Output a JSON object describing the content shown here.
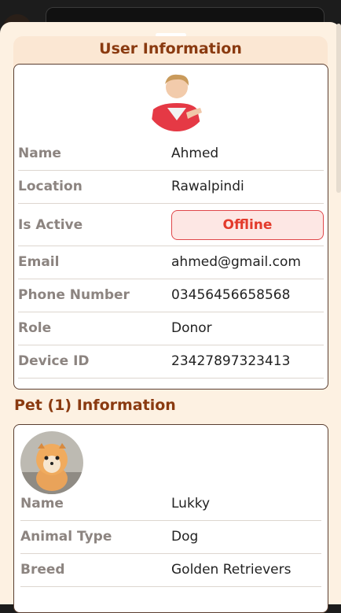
{
  "user_section": {
    "title": "User Information",
    "fields": [
      {
        "label": "Name",
        "value": "Ahmed"
      },
      {
        "label": "Location",
        "value": "Rawalpindi"
      },
      {
        "label": "Is Active",
        "value": "Offline"
      },
      {
        "label": "Email",
        "value": "ahmed@gmail.com"
      },
      {
        "label": "Phone Number",
        "value": "03456456658568"
      },
      {
        "label": "Role",
        "value": "Donor"
      },
      {
        "label": "Device ID",
        "value": "23427897323413"
      }
    ]
  },
  "pet_section": {
    "title": "Pet (1) Information",
    "fields": [
      {
        "label": "Name",
        "value": "Lukky"
      },
      {
        "label": "Animal Type",
        "value": "Dog"
      },
      {
        "label": "Breed",
        "value": "Golden Retrievers"
      }
    ]
  },
  "colors": {
    "accent": "#8a3a10",
    "status_offline": "#e33a2b",
    "sheet_bg": "#fdf1e2"
  }
}
